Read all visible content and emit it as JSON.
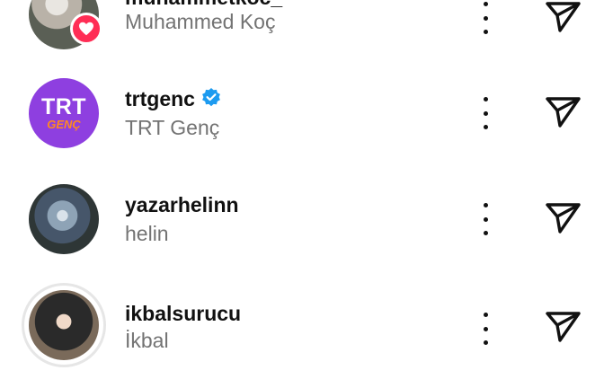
{
  "accounts": [
    {
      "username": "muhammetkoc_",
      "full_name": "Muhammed Koç",
      "avatar": "profile-photo",
      "has_heart_badge": true,
      "verified": false
    },
    {
      "username": "trtgenc",
      "full_name": "TRT Genç",
      "avatar": "trt-genc-logo",
      "avatar_text": "TRT",
      "avatar_subtext": "GENÇ",
      "has_heart_badge": false,
      "verified": true
    },
    {
      "username": "yazarhelinn",
      "full_name": "helin",
      "avatar": "profile-photo",
      "has_heart_badge": false,
      "verified": false
    },
    {
      "username": "ikbalsurucu",
      "full_name": "İkbal",
      "avatar": "profile-photo-with-story-ring",
      "has_heart_badge": false,
      "verified": false
    }
  ],
  "icons": {
    "more": "more-options-icon",
    "send": "send-icon",
    "verified": "verified-badge-icon",
    "heart": "heart-icon"
  },
  "colors": {
    "username": "#111111",
    "full_name": "#737373",
    "verified_blue": "#1d9bf0",
    "heart_badge": "#ff2d55",
    "trt_purple": "#8e3fe0",
    "trt_orange": "#ff8a1f"
  }
}
